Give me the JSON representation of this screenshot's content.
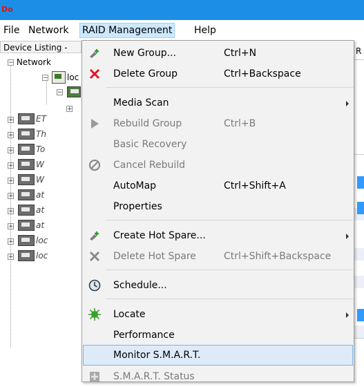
{
  "app": {
    "icon_text": "Do"
  },
  "menubar": {
    "items": [
      "File",
      "Network",
      "RAID Management",
      "Help"
    ]
  },
  "left_pane": {
    "header": "Device Listing -",
    "root_label": "Network",
    "host_label": "loc",
    "device_labels": [
      "ET",
      "Th",
      "To",
      "W",
      "W",
      "at",
      "at",
      "at",
      "loc",
      "loc"
    ]
  },
  "right_strip": {
    "header": "R"
  },
  "dropdown": {
    "items": [
      {
        "label": "New Group...",
        "shortcut": "Ctrl+N",
        "icon": "new-group-icon",
        "disabled": false
      },
      {
        "label": "Delete Group",
        "shortcut": "Ctrl+Backspace",
        "icon": "delete-icon",
        "disabled": false
      },
      {
        "label": "Media Scan",
        "shortcut": "",
        "icon": "",
        "disabled": false,
        "submenu": true
      },
      {
        "label": "Rebuild Group",
        "shortcut": "Ctrl+B",
        "icon": "play-icon",
        "disabled": true
      },
      {
        "label": "Basic Recovery",
        "shortcut": "",
        "icon": "",
        "disabled": true
      },
      {
        "label": "Cancel Rebuild",
        "shortcut": "",
        "icon": "cancel-icon",
        "disabled": true
      },
      {
        "label": "AutoMap",
        "shortcut": "Ctrl+Shift+A",
        "icon": "",
        "disabled": false
      },
      {
        "label": "Properties",
        "shortcut": "",
        "icon": "",
        "disabled": false
      },
      {
        "label": "Create Hot Spare...",
        "shortcut": "",
        "icon": "hot-spare-icon",
        "disabled": false,
        "submenu": true
      },
      {
        "label": "Delete Hot Spare",
        "shortcut": "Ctrl+Shift+Backspace",
        "icon": "delete-disabled-icon",
        "disabled": true
      },
      {
        "label": "Schedule...",
        "shortcut": "",
        "icon": "clock-icon",
        "disabled": false
      },
      {
        "label": "Locate",
        "shortcut": "",
        "icon": "locate-icon",
        "disabled": false,
        "submenu": true
      },
      {
        "label": "Performance",
        "shortcut": "",
        "icon": "",
        "disabled": false
      },
      {
        "label": "Monitor S.M.A.R.T.",
        "shortcut": "",
        "icon": "",
        "disabled": false,
        "highlighted": true
      },
      {
        "label": "S.M.A.R.T. Status",
        "shortcut": "",
        "icon": "smart-status-icon",
        "disabled": true
      }
    ]
  },
  "colors": {
    "title_bar": "#1c8ee6",
    "menu_bg": "#f2f2f2",
    "highlight": "#ddebf8",
    "selection_blue": "#3399ff",
    "delete_red": "#e81123"
  }
}
